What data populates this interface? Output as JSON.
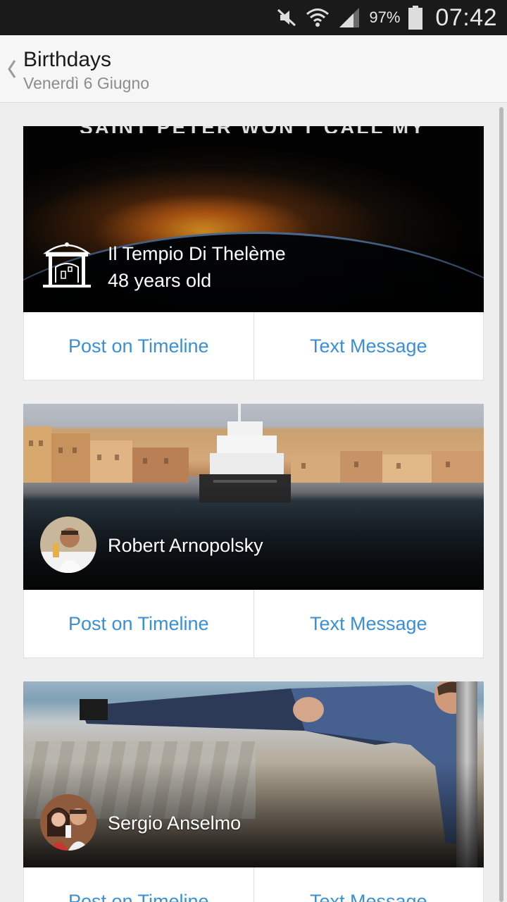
{
  "status_bar": {
    "battery_percent": "97%",
    "time": "07:42",
    "icons": [
      "mute-icon",
      "wifi-icon",
      "signal-icon",
      "battery-icon"
    ]
  },
  "action_bar": {
    "title": "Birthdays",
    "subtitle": "Venerdì 6 Giugno"
  },
  "cards": [
    {
      "name": "Il Tempio Di Thelème",
      "age": "48 years old",
      "banner_text": "SAINT PETER WON'T CALL MY NAME",
      "post_label": "Post on Timeline",
      "text_label": "Text Message"
    },
    {
      "name": "Robert Arnopolsky",
      "post_label": "Post on Timeline",
      "text_label": "Text Message"
    },
    {
      "name": "Sergio Anselmo",
      "post_label": "Post on Timeline",
      "text_label": "Text Message"
    }
  ],
  "colors": {
    "accent": "#3b8fd4",
    "status_bar_bg": "#1a1a1a",
    "action_bar_bg": "#f6f6f6",
    "page_bg": "#eeeeee"
  }
}
